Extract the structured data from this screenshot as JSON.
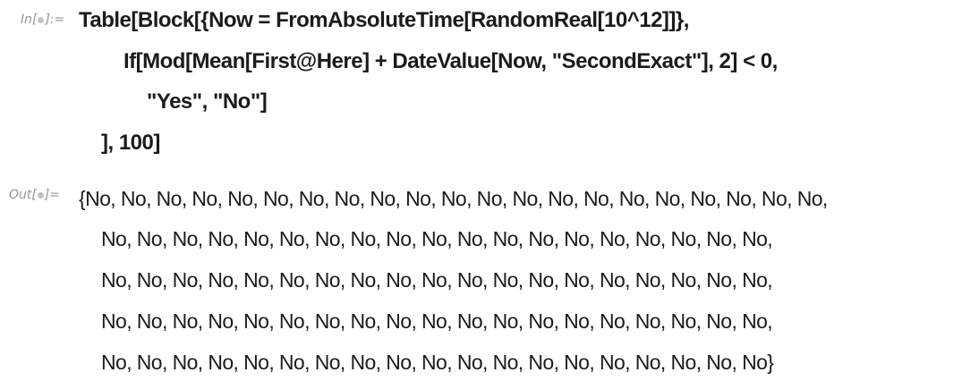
{
  "input_cell": {
    "label_prefix": "In[",
    "label_suffix": "]:=",
    "lines": [
      "Table[Block[{Now = FromAbsoluteTime[RandomReal[10^12]]},",
      "If[Mod[Mean[First@Here] + DateValue[Now, \"SecondExact\"], 2] < 0,",
      "\"Yes\", \"No\"]",
      "], 100]"
    ]
  },
  "output_cell": {
    "label_prefix": "Out[",
    "label_suffix": "]=",
    "lines": [
      "{No, No, No, No, No, No, No, No, No, No, No, No, No, No, No, No, No, No, No, No, No,",
      "No, No, No, No, No, No, No, No, No, No, No, No, No, No, No, No, No, No, No,",
      "No, No, No, No, No, No, No, No, No, No, No, No, No, No, No, No, No, No, No,",
      "No, No, No, No, No, No, No, No, No, No, No, No, No, No, No, No, No, No, No,",
      "No, No, No, No, No, No, No, No, No, No, No, No, No, No, No, No, No, No, No}"
    ]
  }
}
